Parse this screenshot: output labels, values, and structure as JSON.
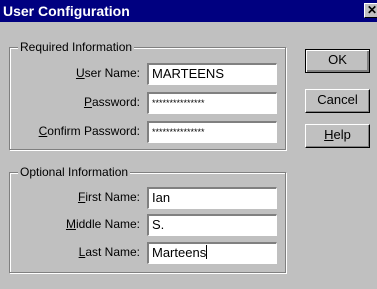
{
  "window": {
    "title": "User Configuration",
    "close_glyph": "✕"
  },
  "required": {
    "legend": "Required Information",
    "user_name": {
      "label_mn": "U",
      "label_rest": "ser Name:",
      "value": "MARTEENS"
    },
    "password": {
      "label_mn": "P",
      "label_rest": "assword:",
      "value": "***************"
    },
    "confirm_password": {
      "label_mn": "C",
      "label_rest": "onfirm Password:",
      "value": "***************"
    }
  },
  "optional": {
    "legend": "Optional Information",
    "first_name": {
      "label_mn": "F",
      "label_rest": "irst Name:",
      "value": "Ian"
    },
    "middle_name": {
      "label_mn": "M",
      "label_rest": "iddle Name:",
      "value": "S."
    },
    "last_name": {
      "label_mn": "L",
      "label_rest": "ast Name:",
      "value": "Marteens"
    }
  },
  "buttons": {
    "ok": "OK",
    "cancel": "Cancel",
    "help_mn": "H",
    "help_rest": "elp"
  }
}
